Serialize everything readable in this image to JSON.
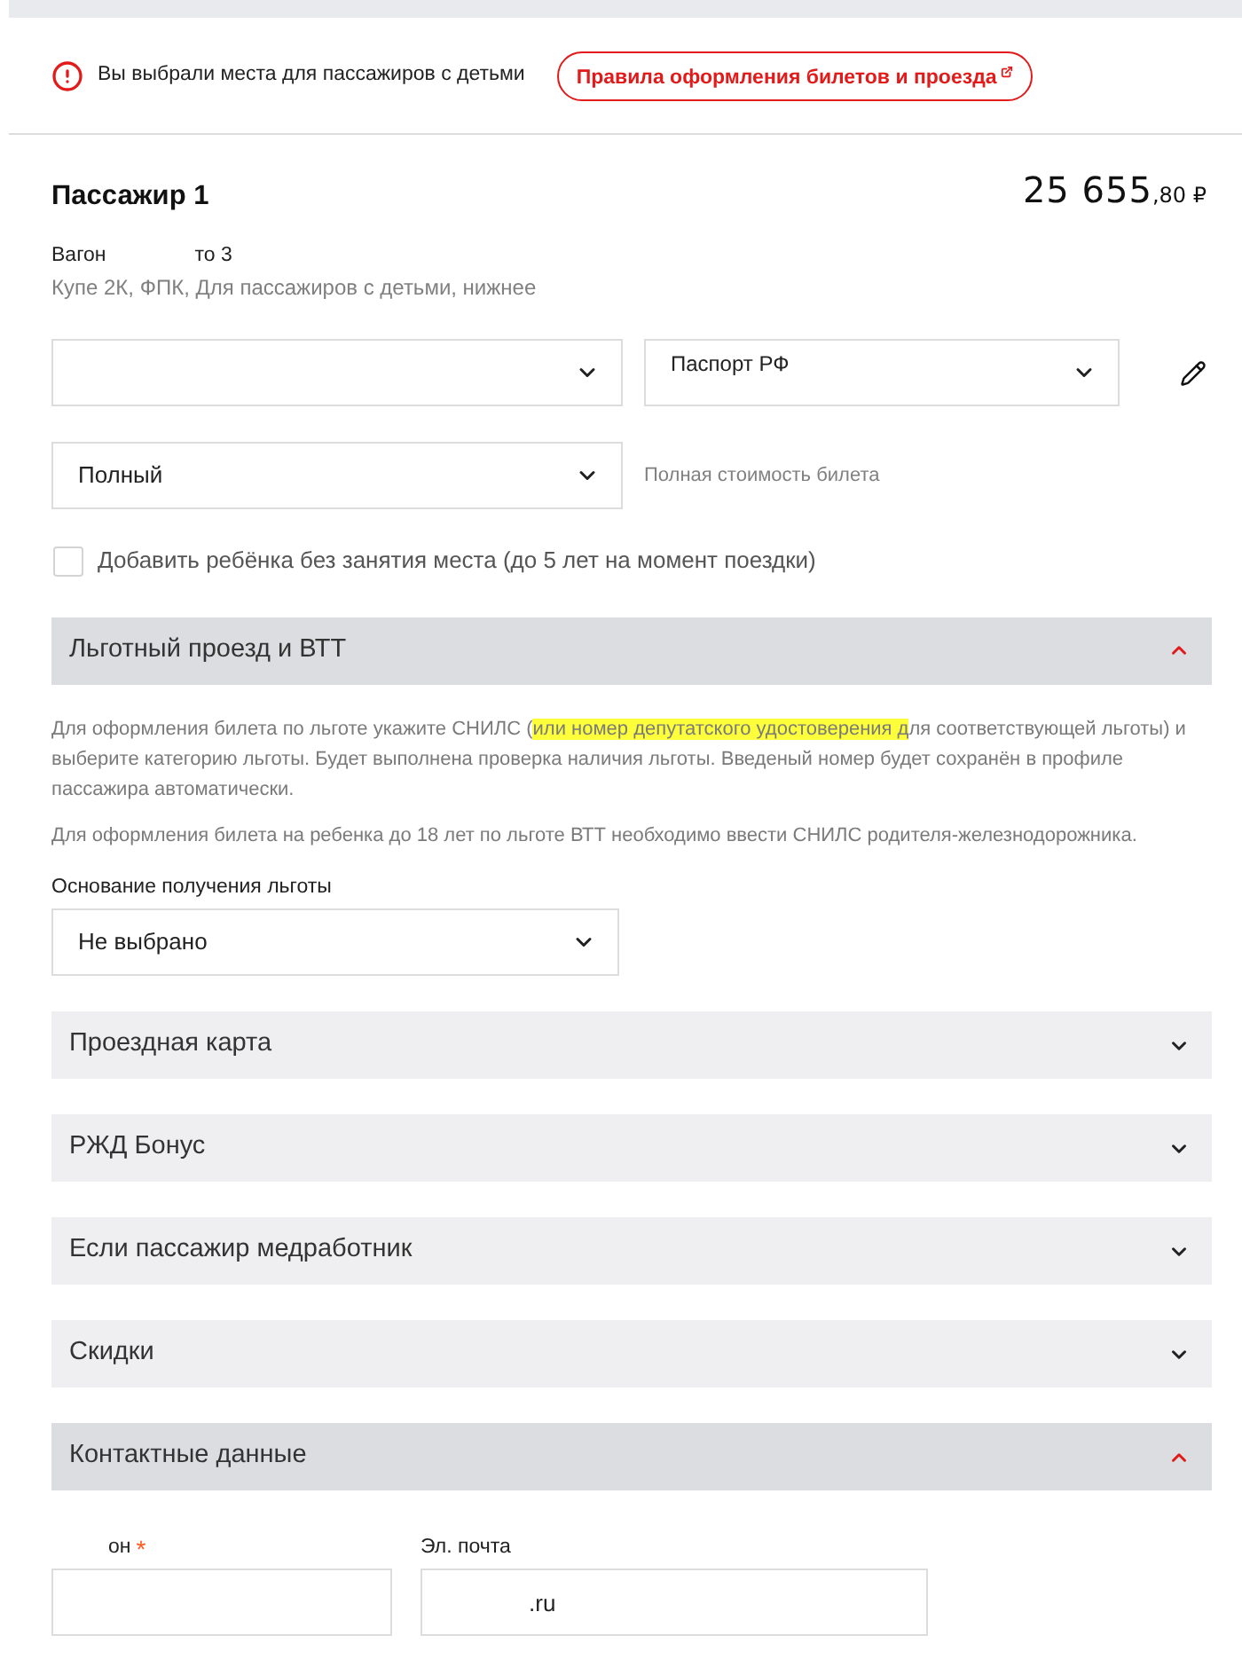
{
  "alert": {
    "message": "Вы выбрали места для пассажиров с детьми",
    "link": "Правила оформления билетов и проезда"
  },
  "passenger": {
    "title": "Пассажир 1",
    "price": {
      "whole": "25 655",
      "fraction": ",80",
      "currency": "₽"
    },
    "car_line": [
      "Вагон",
      "то 3"
    ],
    "seat_details": "Купе 2К, ФПК, Для пассажиров с детьми, нижнее"
  },
  "fields": {
    "document_select": {
      "label": "Паспорт РФ"
    },
    "tariff_select": {
      "value": "Полный"
    },
    "tariff_note": "Полная стоимость билета"
  },
  "child_checkbox": {
    "label": "Добавить ребёнка без занятия места (до 5 лет на момент поездки)",
    "checked": false
  },
  "sections": [
    {
      "kind": "benefits",
      "title": "Льготный проезд и ВТТ",
      "expanded": true,
      "paragraphs": [
        [
          {
            "text": "Для оформления билета по льготе укажите СНИЛС (",
            "highlighted": false
          },
          {
            "text": "или номер депутатского удостоверения д",
            "highlighted": true
          },
          {
            "text": "ля соответствующей льготы) и выберите категорию льготы. Будет выполнена проверка наличия льготы. Введеный номер будет сохранён в профиле пассажира автоматически.",
            "highlighted": false
          }
        ],
        [
          {
            "text": "Для оформления билета на ребенка до 18 лет по льготе ВТТ необходимо ввести СНИЛС родителя-железнодорожника.",
            "highlighted": false
          }
        ]
      ],
      "field_label": "Основание получения льготы",
      "field_value": "Не выбрано"
    },
    {
      "title": "Проездная карта",
      "expanded": false
    },
    {
      "title": "РЖД Бонус",
      "expanded": false
    },
    {
      "title": "Если пассажир медработник",
      "expanded": false
    },
    {
      "title": "Скидки",
      "expanded": false
    },
    {
      "kind": "contacts",
      "title": "Контактные данные",
      "expanded": true,
      "fields": [
        {
          "label": "он",
          "required_mark": "*"
        },
        {
          "label": "Эл. почта",
          "value": ".ru"
        }
      ]
    }
  ]
}
